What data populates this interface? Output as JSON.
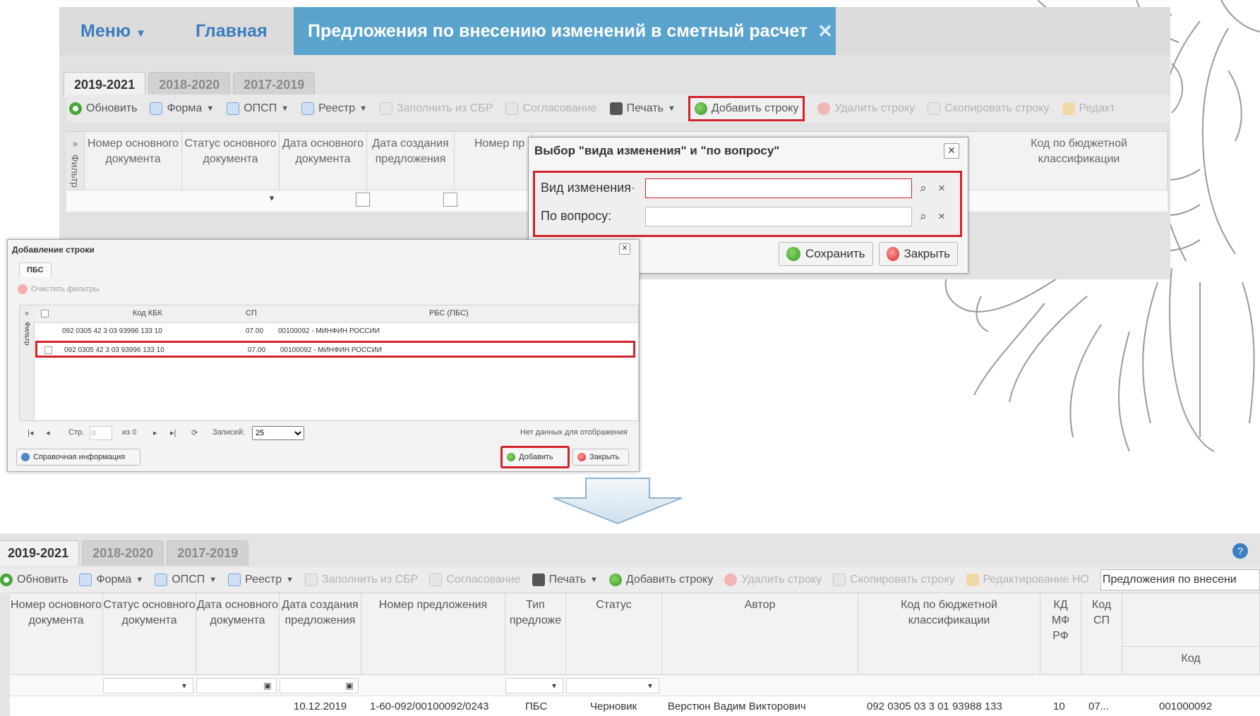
{
  "top_window": {
    "menu": {
      "menu_label": "Меню",
      "home_label": "Главная"
    },
    "active_tab": {
      "title": "Предложения по внесению изменений в сметный расчет",
      "close": "✕"
    },
    "year_tabs": [
      "2019-2021",
      "2018-2020",
      "2017-2019"
    ],
    "toolbar": {
      "refresh": "Обновить",
      "form": "Форма",
      "opsp": "ОПСП",
      "registry": "Реестр",
      "fill_sbr": "Заполнить из СБР",
      "approval": "Согласование",
      "print": "Печать",
      "add_row": "Добавить строку",
      "delete_row": "Удалить строку",
      "copy_row": "Скопировать строку",
      "edit": "Редакт"
    },
    "filter_side": "Фильтр",
    "columns": {
      "doc_number": "Номер основного документа",
      "doc_status": "Статус основного документа",
      "doc_date": "Дата основного документа",
      "created_date": "Дата создания предложения",
      "proposal_number": "Номер пр",
      "kbk": "Код по бюджетной классификации"
    }
  },
  "vid_dialog": {
    "title": "Выбор \"вида изменения\" и \"по вопросу\"",
    "close": "✕",
    "field_vid_label": "Вид изменения",
    "field_vid_value": "",
    "field_question_label": "По вопросу:",
    "field_question_value": "",
    "save": "Сохранить",
    "close_btn": "Закрыть"
  },
  "add_dialog": {
    "title": "Добавление строки",
    "close": "✕",
    "tab": "ПБС",
    "clear_filters": "Очистить фильтры",
    "filter_side": "Фильтр",
    "headers": {
      "kbk": "Код КБК",
      "sp": "СП",
      "rbs": "РБС (ПБС)"
    },
    "rows": [
      {
        "kbk": "092 0305 42 3 03 93996 133 10",
        "sp": "07.00",
        "rbs": "00100092 - МИНФИН РОССИИ"
      },
      {
        "kbk": "092 0305 42 3 03 93996 133 10",
        "sp": "07.00",
        "rbs": "00100092 - МИНФИН РОССИИ"
      }
    ],
    "pager": {
      "page_label": "Стр.",
      "page_value": "0",
      "of_label": "из 0",
      "records_label": "Записей:",
      "records_value": "25",
      "no_data": "Нет данных для отображения"
    },
    "help": "Справочная информация",
    "add": "Добавить",
    "close_btn": "Закрыть"
  },
  "bottom_window": {
    "year_tabs": [
      "2019-2021",
      "2018-2020",
      "2017-2019"
    ],
    "toolbar": {
      "refresh": "Обновить",
      "form": "Форма",
      "opsp": "ОПСП",
      "registry": "Реестр",
      "fill_sbr": "Заполнить из СБР",
      "approval": "Согласование",
      "print": "Печать",
      "add_row": "Добавить строку",
      "delete_row": "Удалить строку",
      "copy_row": "Скопировать строку",
      "edit_no": "Редактирование НО",
      "search_value": "Предложения по внесени"
    },
    "columns": {
      "doc_number": "Номер основного документа",
      "doc_status": "Статус основного документа",
      "doc_date": "Дата основного документа",
      "created_date": "Дата создания предложения",
      "proposal_number": "Номер предложения",
      "proposal_type": "Тип предложе",
      "status": "Статус",
      "author": "Автор",
      "kbk": "Код по бюджетной классификации",
      "kd_mf": "КД МФ РФ",
      "code_sp": "Код СП",
      "code": "Код"
    },
    "row": {
      "created_date": "10.12.2019",
      "proposal_number": "1-60-092/00100092/0243",
      "proposal_type": "ПБС",
      "status": "Черновик",
      "author": "Верстюн Вадим Викторович",
      "kbk": "092  0305 03 3 01 93988 133",
      "kd_mf": "10",
      "code_sp": "07...",
      "code": "001000092"
    }
  },
  "colors": {
    "accent_tab": "#5aa3cd",
    "menu_text": "#3b7cbf",
    "highlight": "#d2232a"
  }
}
